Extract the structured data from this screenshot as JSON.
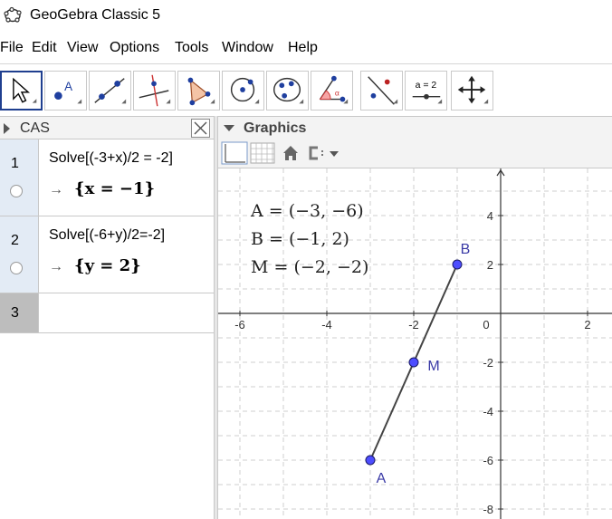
{
  "window": {
    "title": "GeoGebra Classic 5"
  },
  "menu": [
    "File",
    "Edit",
    "View",
    "Options",
    "Tools",
    "Window",
    "Help"
  ],
  "toolbar": {
    "tools": [
      "move-tool",
      "point-tool",
      "line-tool",
      "perpendicular-line-tool",
      "polygon-tool",
      "circle-center-point-tool",
      "conic-through-points-tool",
      "angle-tool",
      "reflect-tool",
      "slider-tool",
      "move-graphics-view-tool"
    ],
    "slider_label": "a = 2"
  },
  "cas": {
    "title": "CAS",
    "rows": [
      {
        "num": "1",
        "input": "Solve[(-3+x)/2 = -2]",
        "arrow": "→",
        "output": "{x = −1}"
      },
      {
        "num": "2",
        "input": "Solve[(-6+y)/2=-2]",
        "arrow": "→",
        "output": "{y = 2}"
      },
      {
        "num": "3",
        "input": "",
        "arrow": "",
        "output": ""
      }
    ]
  },
  "graphics": {
    "title": "Graphics",
    "algebra": [
      "A  =  (−3, −6)",
      "B  =  (−1, 2)",
      "M  =  (−2, −2)"
    ],
    "x_ticks": [
      "-6",
      "-4",
      "-2",
      "0",
      "2"
    ],
    "y_ticks": [
      "4",
      "2",
      "-2",
      "-4",
      "-6",
      "-8"
    ],
    "points": [
      {
        "label": "A",
        "x": -3,
        "y": -6
      },
      {
        "label": "B",
        "x": -1,
        "y": 2
      },
      {
        "label": "M",
        "x": -2,
        "y": -2
      }
    ],
    "colors": {
      "point": "#4d4dff",
      "label": "#3a3aa6",
      "segment": "#444444",
      "grid": "#cfcfcf"
    }
  }
}
